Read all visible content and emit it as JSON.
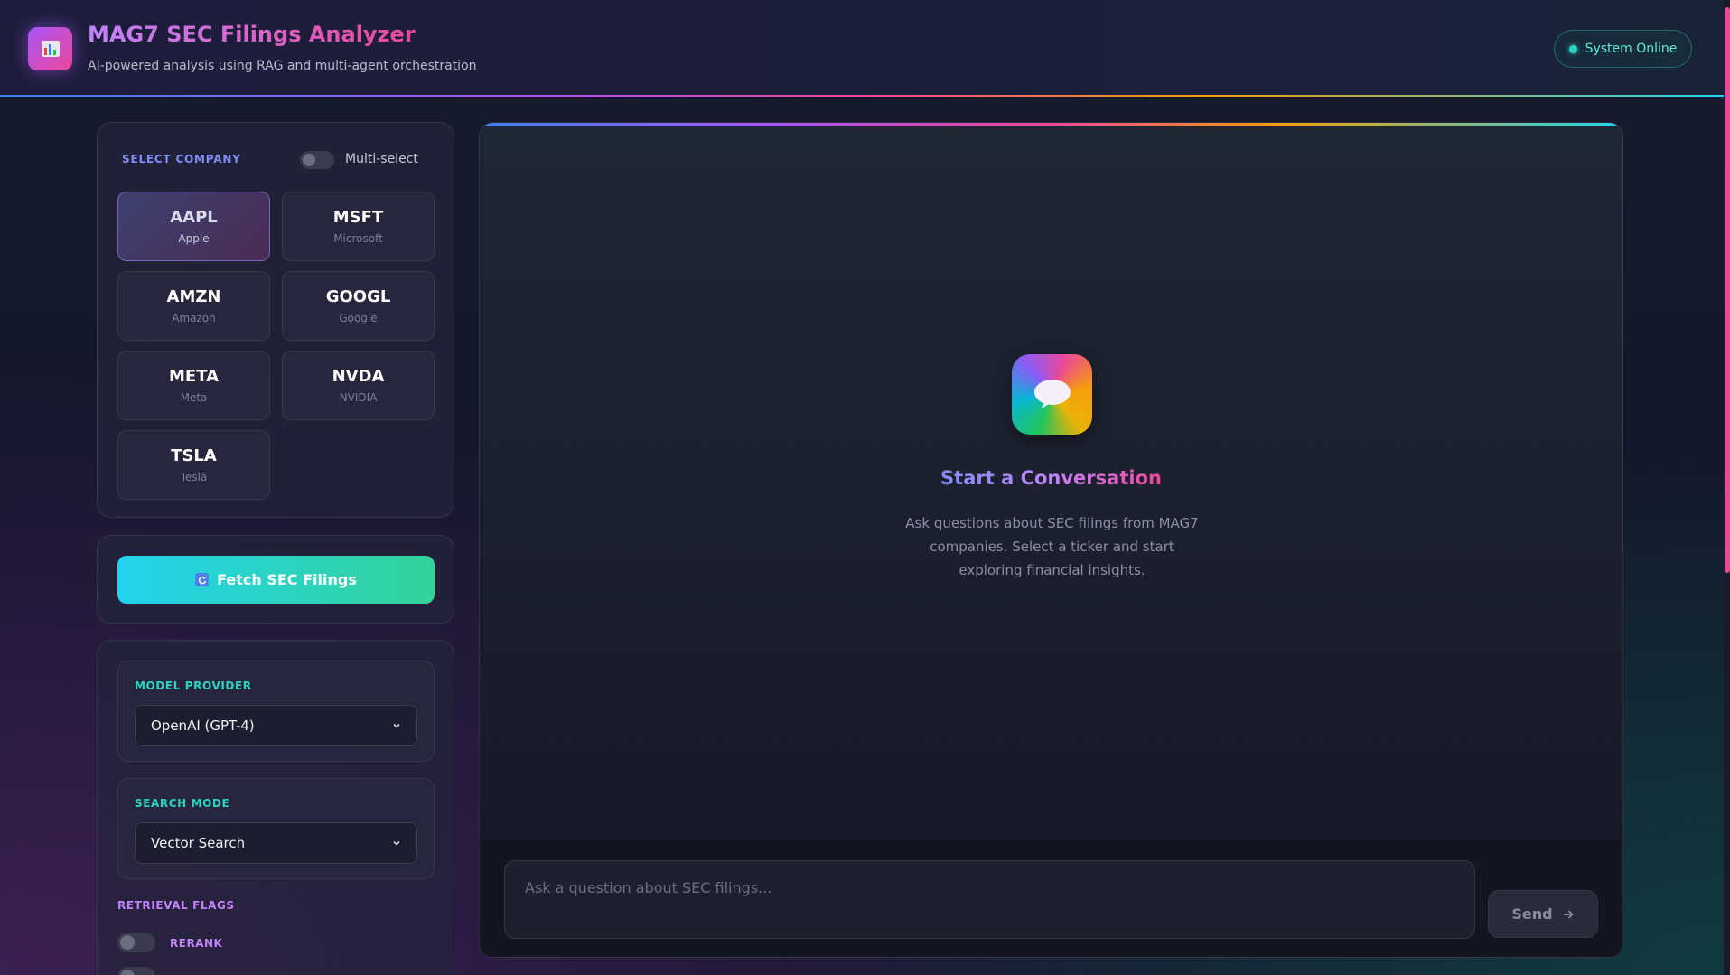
{
  "header": {
    "title": "MAG7 SEC Filings Analyzer",
    "subtitle": "AI-powered analysis using RAG and multi-agent orchestration",
    "status": "System Online"
  },
  "company_selector": {
    "label": "SELECT COMPANY",
    "multi_select_label": "Multi-select",
    "multi_select_on": false,
    "selected": "AAPL",
    "companies": [
      {
        "ticker": "AAPL",
        "name": "Apple"
      },
      {
        "ticker": "MSFT",
        "name": "Microsoft"
      },
      {
        "ticker": "AMZN",
        "name": "Amazon"
      },
      {
        "ticker": "GOOGL",
        "name": "Google"
      },
      {
        "ticker": "META",
        "name": "Meta"
      },
      {
        "ticker": "NVDA",
        "name": "NVIDIA"
      },
      {
        "ticker": "TSLA",
        "name": "Tesla"
      }
    ]
  },
  "fetch": {
    "label": "Fetch SEC Filings",
    "icon": "refresh-icon"
  },
  "settings": {
    "model_provider": {
      "label": "MODEL PROVIDER",
      "value": "OpenAI (GPT-4)"
    },
    "search_mode": {
      "label": "SEARCH MODE",
      "value": "Vector Search"
    },
    "retrieval_flags": {
      "label": "RETRIEVAL FLAGS",
      "flags": [
        {
          "label": "RERANK",
          "on": false
        }
      ]
    }
  },
  "chat": {
    "empty_title": "Start a Conversation",
    "empty_description": "Ask questions about SEC filings from MAG7 companies. Select a ticker and start exploring financial insights.",
    "input_placeholder": "Ask a question about SEC filings...",
    "send_label": "Send"
  },
  "colors": {
    "accent_purple": "#a855f7",
    "accent_pink": "#ec4899",
    "accent_teal": "#2dd4bf",
    "fetch_gradient_start": "#22d3ee",
    "fetch_gradient_end": "#34d399"
  }
}
